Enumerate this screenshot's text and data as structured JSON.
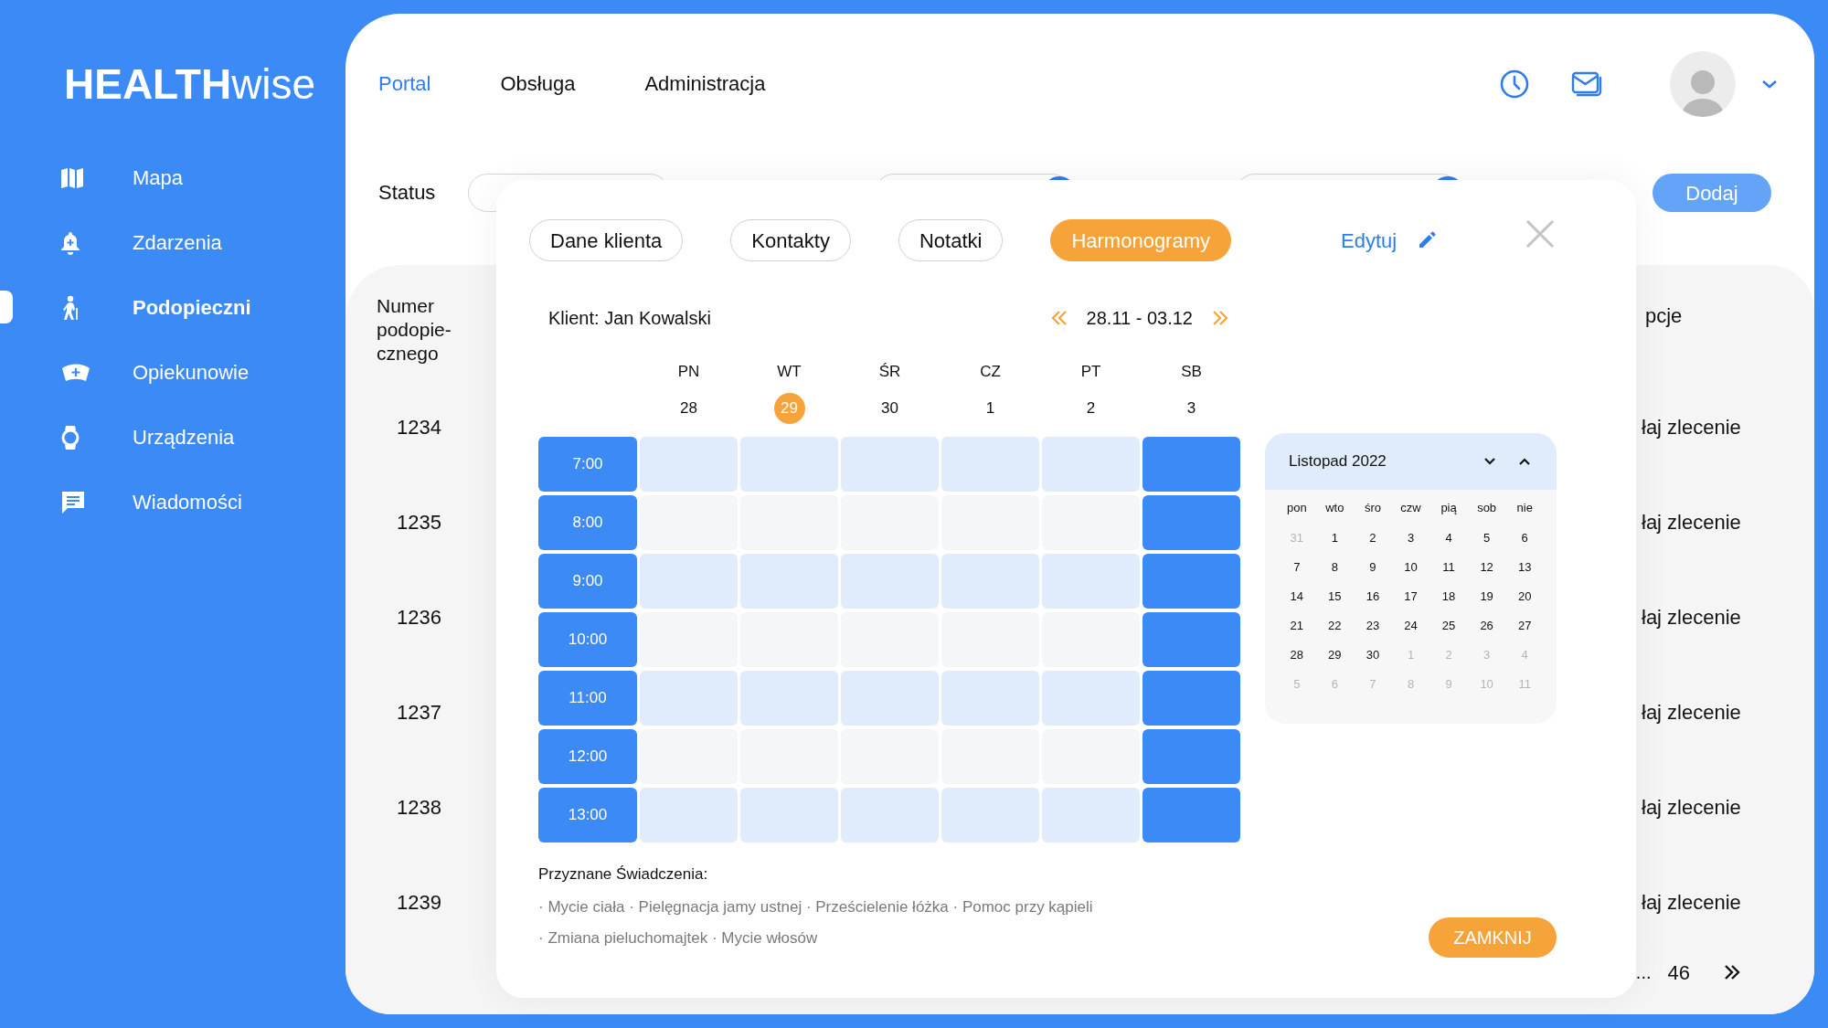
{
  "logo": {
    "bold": "HEALTH",
    "light": "wise"
  },
  "sidebar": {
    "items": [
      {
        "label": "Mapa",
        "selected": false
      },
      {
        "label": "Zdarzenia",
        "selected": false
      },
      {
        "label": "Podopieczni",
        "selected": true
      },
      {
        "label": "Opiekunowie",
        "selected": false
      },
      {
        "label": "Urządzenia",
        "selected": false
      },
      {
        "label": "Wiadomości",
        "selected": false
      }
    ]
  },
  "top_nav": [
    {
      "label": "Portal",
      "selected": true
    },
    {
      "label": "Obsługa",
      "selected": false
    },
    {
      "label": "Administracja",
      "selected": false
    }
  ],
  "filters": {
    "label": "Status"
  },
  "add_button": "Dodaj",
  "table": {
    "columns": [
      "Numer\npodopie-\ncznego",
      "pcje"
    ],
    "rows": [
      {
        "number": "1234",
        "action": "łaj zlecenie"
      },
      {
        "number": "1235",
        "action": "łaj zlecenie"
      },
      {
        "number": "1236",
        "action": "łaj zlecenie"
      },
      {
        "number": "1237",
        "action": "łaj zlecenie"
      },
      {
        "number": "1238",
        "action": "łaj zlecenie"
      },
      {
        "number": "1239",
        "action": "łaj zlecenie"
      }
    ]
  },
  "pagination": {
    "ellipsis": "...",
    "page": "46"
  },
  "modal": {
    "tabs": [
      {
        "label": "Dane klienta",
        "selected": false
      },
      {
        "label": "Kontakty",
        "selected": false
      },
      {
        "label": "Notatki",
        "selected": false
      },
      {
        "label": "Harmonogramy",
        "selected": true
      }
    ],
    "edit": "Edytuj",
    "client": "Klient: Jan Kowalski",
    "week": "28.11 - 03.12",
    "days": [
      {
        "label": "PN",
        "date": "28",
        "today": false,
        "filled": false
      },
      {
        "label": "WT",
        "date": "29",
        "today": true,
        "filled": false
      },
      {
        "label": "ŚR",
        "date": "30",
        "today": false,
        "filled": false
      },
      {
        "label": "CZ",
        "date": "1",
        "today": false,
        "filled": false
      },
      {
        "label": "PT",
        "date": "2",
        "today": false,
        "filled": false
      },
      {
        "label": "SB",
        "date": "3",
        "today": false,
        "filled": true
      }
    ],
    "times": [
      "7:00",
      "8:00",
      "9:00",
      "10:00",
      "11:00",
      "12:00",
      "13:00"
    ],
    "calendar": {
      "title": "Listopad 2022",
      "weekdays": [
        "pon",
        "wto",
        "śro",
        "czw",
        "pią",
        "sob",
        "nie"
      ],
      "weeks": [
        [
          {
            "day": "31",
            "muted": true
          },
          {
            "day": "1",
            "muted": false
          },
          {
            "day": "2",
            "muted": false
          },
          {
            "day": "3",
            "muted": false
          },
          {
            "day": "4",
            "muted": false
          },
          {
            "day": "5",
            "muted": false
          },
          {
            "day": "6",
            "muted": false
          }
        ],
        [
          {
            "day": "7",
            "muted": false
          },
          {
            "day": "8",
            "muted": false
          },
          {
            "day": "9",
            "muted": false
          },
          {
            "day": "10",
            "muted": false
          },
          {
            "day": "11",
            "muted": false
          },
          {
            "day": "12",
            "muted": false
          },
          {
            "day": "13",
            "muted": false
          }
        ],
        [
          {
            "day": "14",
            "muted": false
          },
          {
            "day": "15",
            "muted": false
          },
          {
            "day": "16",
            "muted": false
          },
          {
            "day": "17",
            "muted": false
          },
          {
            "day": "18",
            "muted": false
          },
          {
            "day": "19",
            "muted": false
          },
          {
            "day": "20",
            "muted": false
          }
        ],
        [
          {
            "day": "21",
            "muted": false
          },
          {
            "day": "22",
            "muted": false
          },
          {
            "day": "23",
            "muted": false
          },
          {
            "day": "24",
            "muted": false
          },
          {
            "day": "25",
            "muted": false
          },
          {
            "day": "26",
            "muted": false
          },
          {
            "day": "27",
            "muted": false
          }
        ],
        [
          {
            "day": "28",
            "muted": false
          },
          {
            "day": "29",
            "muted": false
          },
          {
            "day": "30",
            "muted": false
          },
          {
            "day": "1",
            "muted": true
          },
          {
            "day": "2",
            "muted": true
          },
          {
            "day": "3",
            "muted": true
          },
          {
            "day": "4",
            "muted": true
          }
        ],
        [
          {
            "day": "5",
            "muted": true
          },
          {
            "day": "6",
            "muted": true
          },
          {
            "day": "7",
            "muted": true
          },
          {
            "day": "8",
            "muted": true
          },
          {
            "day": "9",
            "muted": true
          },
          {
            "day": "10",
            "muted": true
          },
          {
            "day": "11",
            "muted": true
          }
        ]
      ]
    },
    "benefits": {
      "title": "Przyznane Świadczenia:",
      "lines": [
        "· Mycie ciała · Pielęgnacja jamy ustnej · Prześcielenie łóżka · Pomoc przy kąpieli",
        "· Zmiana pieluchomajtek · Mycie włosów"
      ]
    },
    "close_button": "ZAMKNIJ"
  }
}
